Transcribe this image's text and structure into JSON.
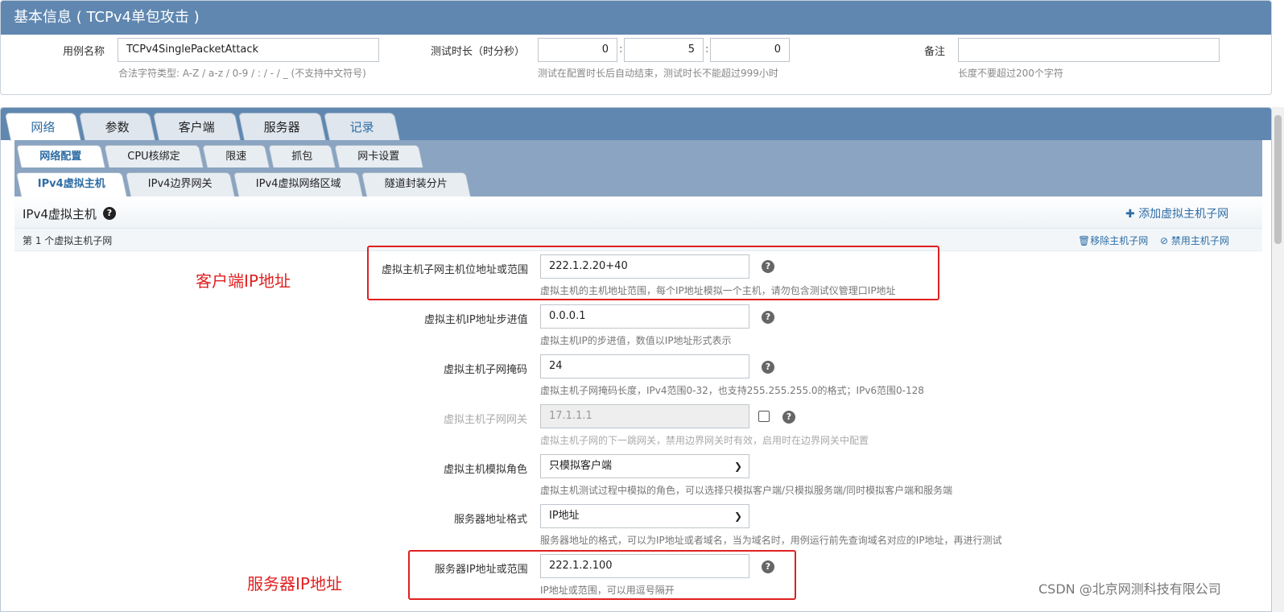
{
  "basic": {
    "title": "基本信息 ( TCPv4单包攻击 )",
    "case_name_label": "用例名称",
    "case_name_value": "TCPv4SinglePacketAttack",
    "case_name_hint": "合法字符类型: A-Z / a-z / 0-9 / : / - / _ (不支持中文符号)",
    "duration_label": "测试时长（时分秒）",
    "duration_h": "0",
    "duration_m": "5",
    "duration_s": "0",
    "duration_sep": ":",
    "duration_hint": "测试在配置时长后自动结束，测试时长不能超过999小时",
    "note_label": "备注",
    "note_value": "",
    "note_hint": "长度不要超过200个字符"
  },
  "main_tabs": [
    "网络",
    "参数",
    "客户端",
    "服务器",
    "记录"
  ],
  "sub_tabs_row1": [
    "网络配置",
    "CPU核绑定",
    "限速",
    "抓包",
    "网卡设置"
  ],
  "sub_tabs_row2": [
    "IPv4虚拟主机",
    "IPv4边界网关",
    "IPv4虚拟网络区域",
    "隧道封装分片"
  ],
  "section": {
    "title": "IPv4虚拟主机",
    "add_link": "添加虚拟主机子网",
    "subnet_label": "第 1 个虚拟主机子网",
    "remove_link": "移除主机子网",
    "disable_link": "禁用主机子网"
  },
  "fields": {
    "ip_range": {
      "label": "虚拟主机子网主机位地址或范围",
      "value": "222.1.2.20+40",
      "hint": "虚拟主机的主机地址范围，每个IP地址模拟一个主机，请勿包含测试仪管理口IP地址"
    },
    "ip_step": {
      "label": "虚拟主机IP地址步进值",
      "value": "0.0.0.1",
      "hint": "虚拟主机IP的步进值，数值以IP地址形式表示"
    },
    "mask": {
      "label": "虚拟主机子网掩码",
      "value": "24",
      "hint": "虚拟主机子网掩码长度，IPv4范围0-32，也支持255.255.255.0的格式；IPv6范围0-128"
    },
    "gateway": {
      "label": "虚拟主机子网网关",
      "value": "17.1.1.1",
      "hint": "虚拟主机子网的下一跳网关，禁用边界网关时有效，启用时在边界网关中配置"
    },
    "role": {
      "label": "虚拟主机模拟角色",
      "value": "只模拟客户端",
      "hint": "虚拟主机测试过程中模拟的角色，可以选择只模拟客户端/只模拟服务端/同时模拟客户端和服务端"
    },
    "server_fmt": {
      "label": "服务器地址格式",
      "value": "IP地址",
      "hint": "服务器地址的格式，可以为IP地址或者域名，当为域名时，用例运行前先查询域名对应的IP地址，再进行测试"
    },
    "server_ip": {
      "label": "服务器IP地址或范围",
      "value": "222.1.2.100",
      "hint": "IP地址或范围，可以用逗号隔开"
    }
  },
  "annotations": {
    "client_ip": "客户端IP地址",
    "server_ip": "服务器IP地址"
  },
  "watermark": "CSDN @北京网测科技有限公司",
  "colors": {
    "header": "#5f87b0",
    "accent": "#2e6da4",
    "annotation": "#e02020"
  }
}
